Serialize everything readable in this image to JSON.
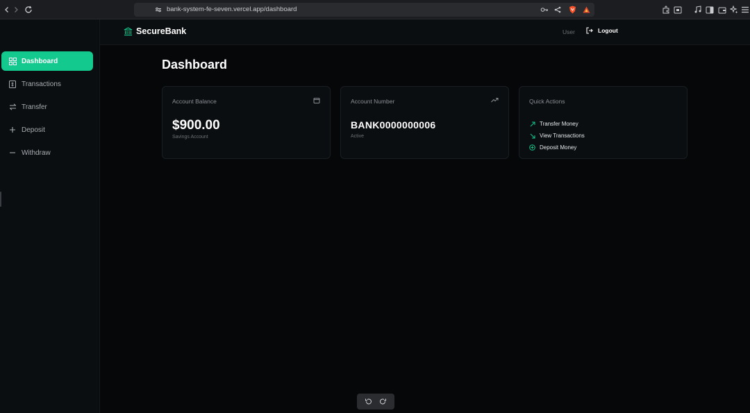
{
  "browser": {
    "url": "bank-system-fe-seven.vercel.app/dashboard"
  },
  "header": {
    "brand": "SecureBank",
    "user_label": "User",
    "logout_label": "Logout"
  },
  "sidebar": {
    "items": [
      {
        "label": "Dashboard",
        "icon": "dashboard-icon",
        "active": true
      },
      {
        "label": "Transactions",
        "icon": "receipt-icon",
        "active": false
      },
      {
        "label": "Transfer",
        "icon": "arrows-icon",
        "active": false
      },
      {
        "label": "Deposit",
        "icon": "plus-icon",
        "active": false
      },
      {
        "label": "Withdraw",
        "icon": "minus-icon",
        "active": false
      }
    ]
  },
  "main": {
    "title": "Dashboard",
    "cards": {
      "balance": {
        "title": "Account Balance",
        "value": "$900.00",
        "sub": "Savings Account",
        "icon": "wallet-icon"
      },
      "account": {
        "title": "Account Number",
        "value": "BANK0000000006",
        "sub": "Active",
        "icon": "trending-up-icon"
      },
      "actions": {
        "title": "Quick Actions",
        "items": [
          {
            "label": "Transfer Money",
            "icon": "arrow-up-right-icon"
          },
          {
            "label": "View Transactions",
            "icon": "arrow-down-right-icon"
          },
          {
            "label": "Deposit Money",
            "icon": "plus-circle-icon"
          }
        ]
      }
    }
  },
  "colors": {
    "accent": "#14c98e",
    "background": "#050708",
    "surface": "#0b0e10"
  }
}
